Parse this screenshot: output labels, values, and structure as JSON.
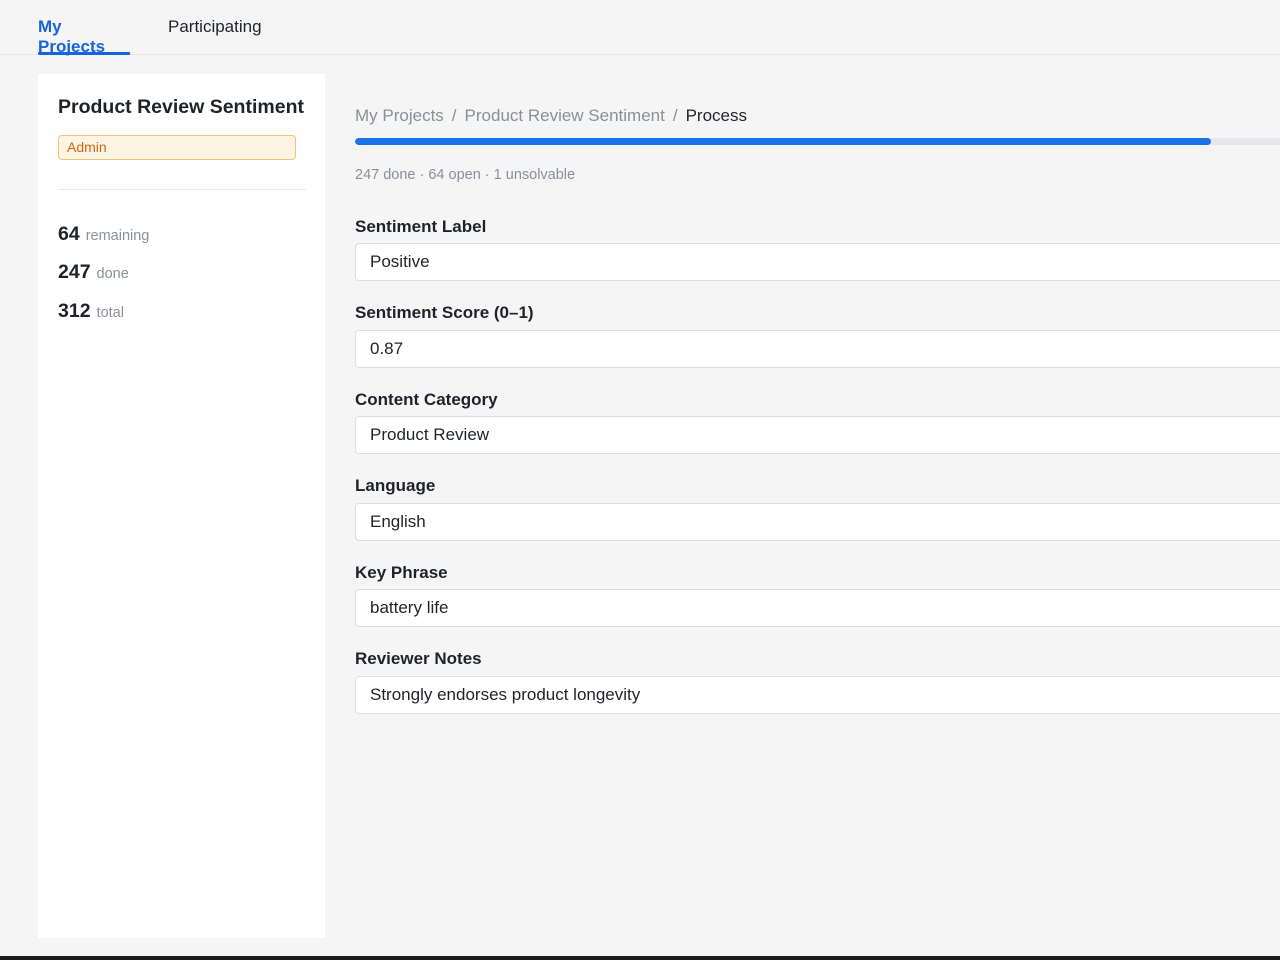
{
  "tabs": [
    {
      "label": "My Projects",
      "active": true
    },
    {
      "label": "Participating",
      "active": false
    }
  ],
  "sidebar": {
    "project_title": "Product Review Sentiment",
    "role_badge": "Admin",
    "stats": [
      {
        "value": "64",
        "label": "remaining"
      },
      {
        "value": "247",
        "label": "done"
      },
      {
        "value": "312",
        "label": "total"
      }
    ]
  },
  "breadcrumb": {
    "items": [
      "My Projects",
      "Product Review Sentiment",
      "Process"
    ],
    "separator": "/"
  },
  "progress": {
    "percent": 92.5,
    "summary": "247 done · 64 open · 1 unsolvable"
  },
  "form": {
    "fields": [
      {
        "label": "Sentiment Label",
        "value": "Positive"
      },
      {
        "label": "Sentiment Score (0–1)",
        "value": "0.87"
      },
      {
        "label": "Content Category",
        "value": "Product Review"
      },
      {
        "label": "Language",
        "value": "English"
      },
      {
        "label": "Key Phrase",
        "value": "battery life"
      },
      {
        "label": "Reviewer Notes",
        "value": "Strongly endorses product longevity"
      }
    ]
  },
  "colors": {
    "accent": "#1664d9",
    "progress": "#1a73e8",
    "badge_bg": "#fdf4e3",
    "badge_text": "#c46a10"
  }
}
